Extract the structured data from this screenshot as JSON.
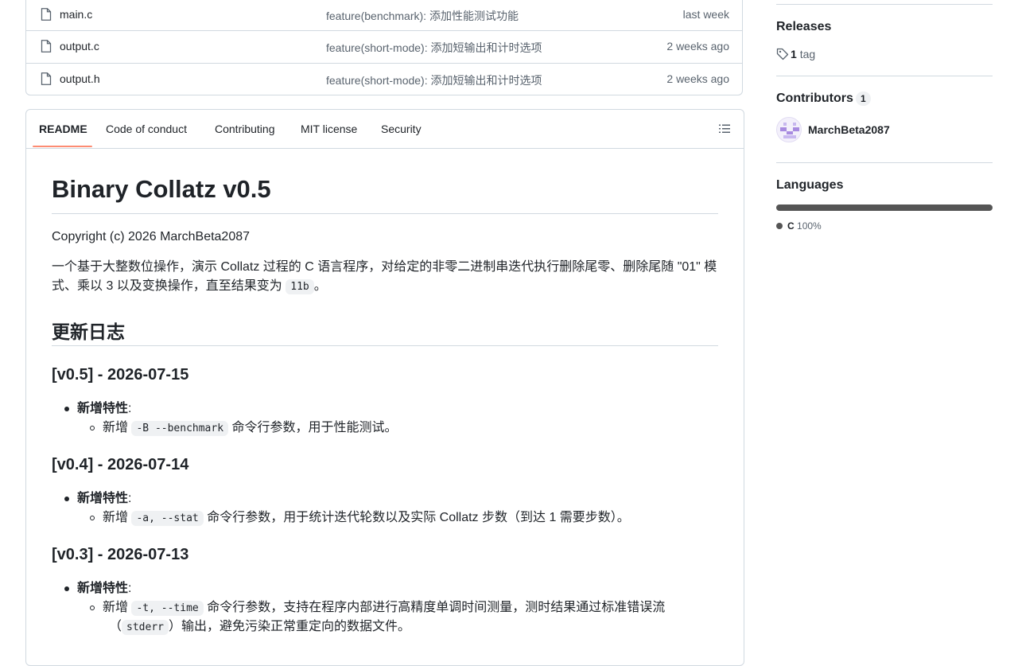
{
  "files": [
    {
      "name": "main.c",
      "message": "feature(benchmark): 添加性能测试功能",
      "date": "last week"
    },
    {
      "name": "output.c",
      "message": "feature(short-mode): 添加短输出和计时选项",
      "date": "2 weeks ago"
    },
    {
      "name": "output.h",
      "message": "feature(short-mode): 添加短输出和计时选项",
      "date": "2 weeks ago"
    }
  ],
  "readme": {
    "tabs": [
      "README",
      "Code of conduct",
      "Contributing",
      "MIT license",
      "Security"
    ],
    "title": "Binary Collatz v0.5",
    "copyright": "Copyright (c) 2026 MarchBeta2087",
    "intro_text": "一个基于大整数位操作，演示 Collatz 过程的 C 语言程序，对给定的非零二进制串迭代执行删除尾零、删除尾随 \"01\" 模式、乘以 3 以及变换操作，直至结果变为",
    "intro_code": "11b",
    "intro_end": "。",
    "changelog_heading": "更新日志",
    "versions": [
      {
        "heading": "[v0.5] - 2026-07-15",
        "feature_label": "新增特性",
        "colon": ":",
        "item_prefix": "新增",
        "item_code": "-B --benchmark",
        "item_text": "命令行参数，用于性能测试。"
      },
      {
        "heading": "[v0.4] - 2026-07-14",
        "feature_label": "新增特性",
        "colon": ":",
        "item_prefix": "新增",
        "item_code": "-a, --stat",
        "item_text": "命令行参数，用于统计迭代轮数以及实际 Collatz 步数（到达 1 需要步数）。"
      },
      {
        "heading": "[v0.3] - 2026-07-13",
        "feature_label": "新增特性",
        "colon": ":",
        "item_prefix": "新增",
        "item_code": "-t, --time",
        "item_text": "命令行参数，支持在程序内部进行高精度单调时间测量，测时结果通过标准错误流",
        "item_line2_open": "（",
        "item_line2_code": "stderr",
        "item_line2_text": "）输出，避免污染正常重定向的数据文件。"
      }
    ]
  },
  "sidebar": {
    "releases": {
      "title": "Releases",
      "tag_count": "1",
      "tag_label": "tag"
    },
    "contributors": {
      "title": "Contributors",
      "count": "1",
      "user": "MarchBeta2087"
    },
    "languages": {
      "title": "Languages",
      "name": "C",
      "percent": "100%",
      "color": "#555555"
    }
  },
  "colors": {
    "tab_underline": "#fd8c73",
    "border": "#d1d9e0",
    "muted_text": "#59636e"
  }
}
